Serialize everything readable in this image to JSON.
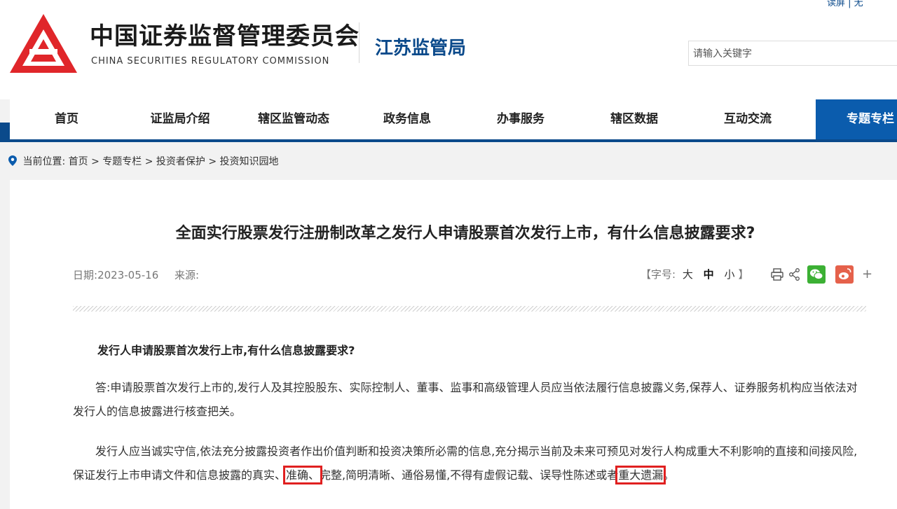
{
  "header": {
    "org_cn": "中国证券监督管理委员会",
    "org_en": "CHINA SECURITIES REGULATORY COMMISSION",
    "bureau": "江苏监管局",
    "top_links": "读屏 | 无",
    "search_placeholder": "请输入关键字",
    "brand_color": "#0b4a8b",
    "logo_color": "#e0262a"
  },
  "nav": {
    "items": [
      {
        "label": "首页"
      },
      {
        "label": "证监局介绍"
      },
      {
        "label": "辖区监管动态"
      },
      {
        "label": "政务信息"
      },
      {
        "label": "办事服务"
      },
      {
        "label": "辖区数据"
      },
      {
        "label": "互动交流"
      },
      {
        "label": "专题专栏"
      }
    ],
    "active_index": 7
  },
  "breadcrumb": {
    "prefix": "当前位置:",
    "items": [
      "首页",
      "专题专栏",
      "投资者保护",
      "投资知识园地"
    ],
    "separator": ">"
  },
  "article": {
    "title": "全面实行股票发行注册制改革之发行人申请股票首次发行上市，有什么信息披露要求?",
    "date_label": "日期:",
    "date": "2023-05-16",
    "source_label": "来源:",
    "font_size_label": "【字号:",
    "font_sizes": [
      "大",
      "中",
      "小"
    ],
    "font_size_close": "】",
    "plus": "+",
    "question": "发行人申请股票首次发行上市,有什么信息披露要求?",
    "para1": "答:申请股票首次发行上市的,发行人及其控股股东、实际控制人、董事、监事和高级管理人员应当依法履行信息披露义务,保荐人、证券服务机构应当依法对发行人的信息披露进行核查把关。",
    "para2_a": "发行人应当诚实守信,依法充分披露投资者作出价值判断和投资决策所必需的信息,充分揭示当前及未来可预见对发行人构成重大不利影响的直接和间接风险,保证发行上市申请文件和信息披露的真实、",
    "para2_mark1": "准确、",
    "para2_b": "完整,简明清晰、通俗易懂,不得有虚假记载、误导性陈述或者",
    "para2_mark2": "重大遗漏",
    "para2_c": "。",
    "highlight_color": "#e02020"
  },
  "icons": [
    "logo-icon",
    "search-icon",
    "location-pin-icon",
    "print-icon",
    "share-icon",
    "wechat-icon",
    "weibo-icon"
  ]
}
